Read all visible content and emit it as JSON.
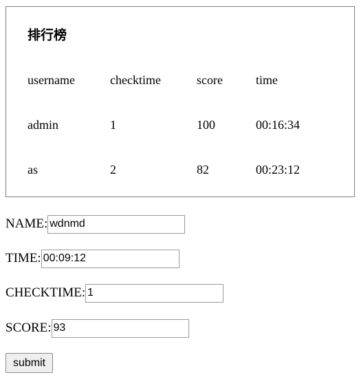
{
  "leaderboard": {
    "title": "排行榜",
    "headers": [
      "username",
      "checktime",
      "score",
      "time"
    ],
    "rows": [
      [
        "admin",
        "1",
        "100",
        "00:16:34"
      ],
      [
        "as",
        "2",
        "82",
        "00:23:12"
      ]
    ]
  },
  "form": {
    "name_label": "NAME:",
    "name_value": "wdnmd",
    "time_label": "TIME:",
    "time_value": "00:09:12",
    "checktime_label": "CHECKTIME:",
    "checktime_value": "1",
    "score_label": "SCORE:",
    "score_value": "93",
    "submit_label": "submit"
  }
}
